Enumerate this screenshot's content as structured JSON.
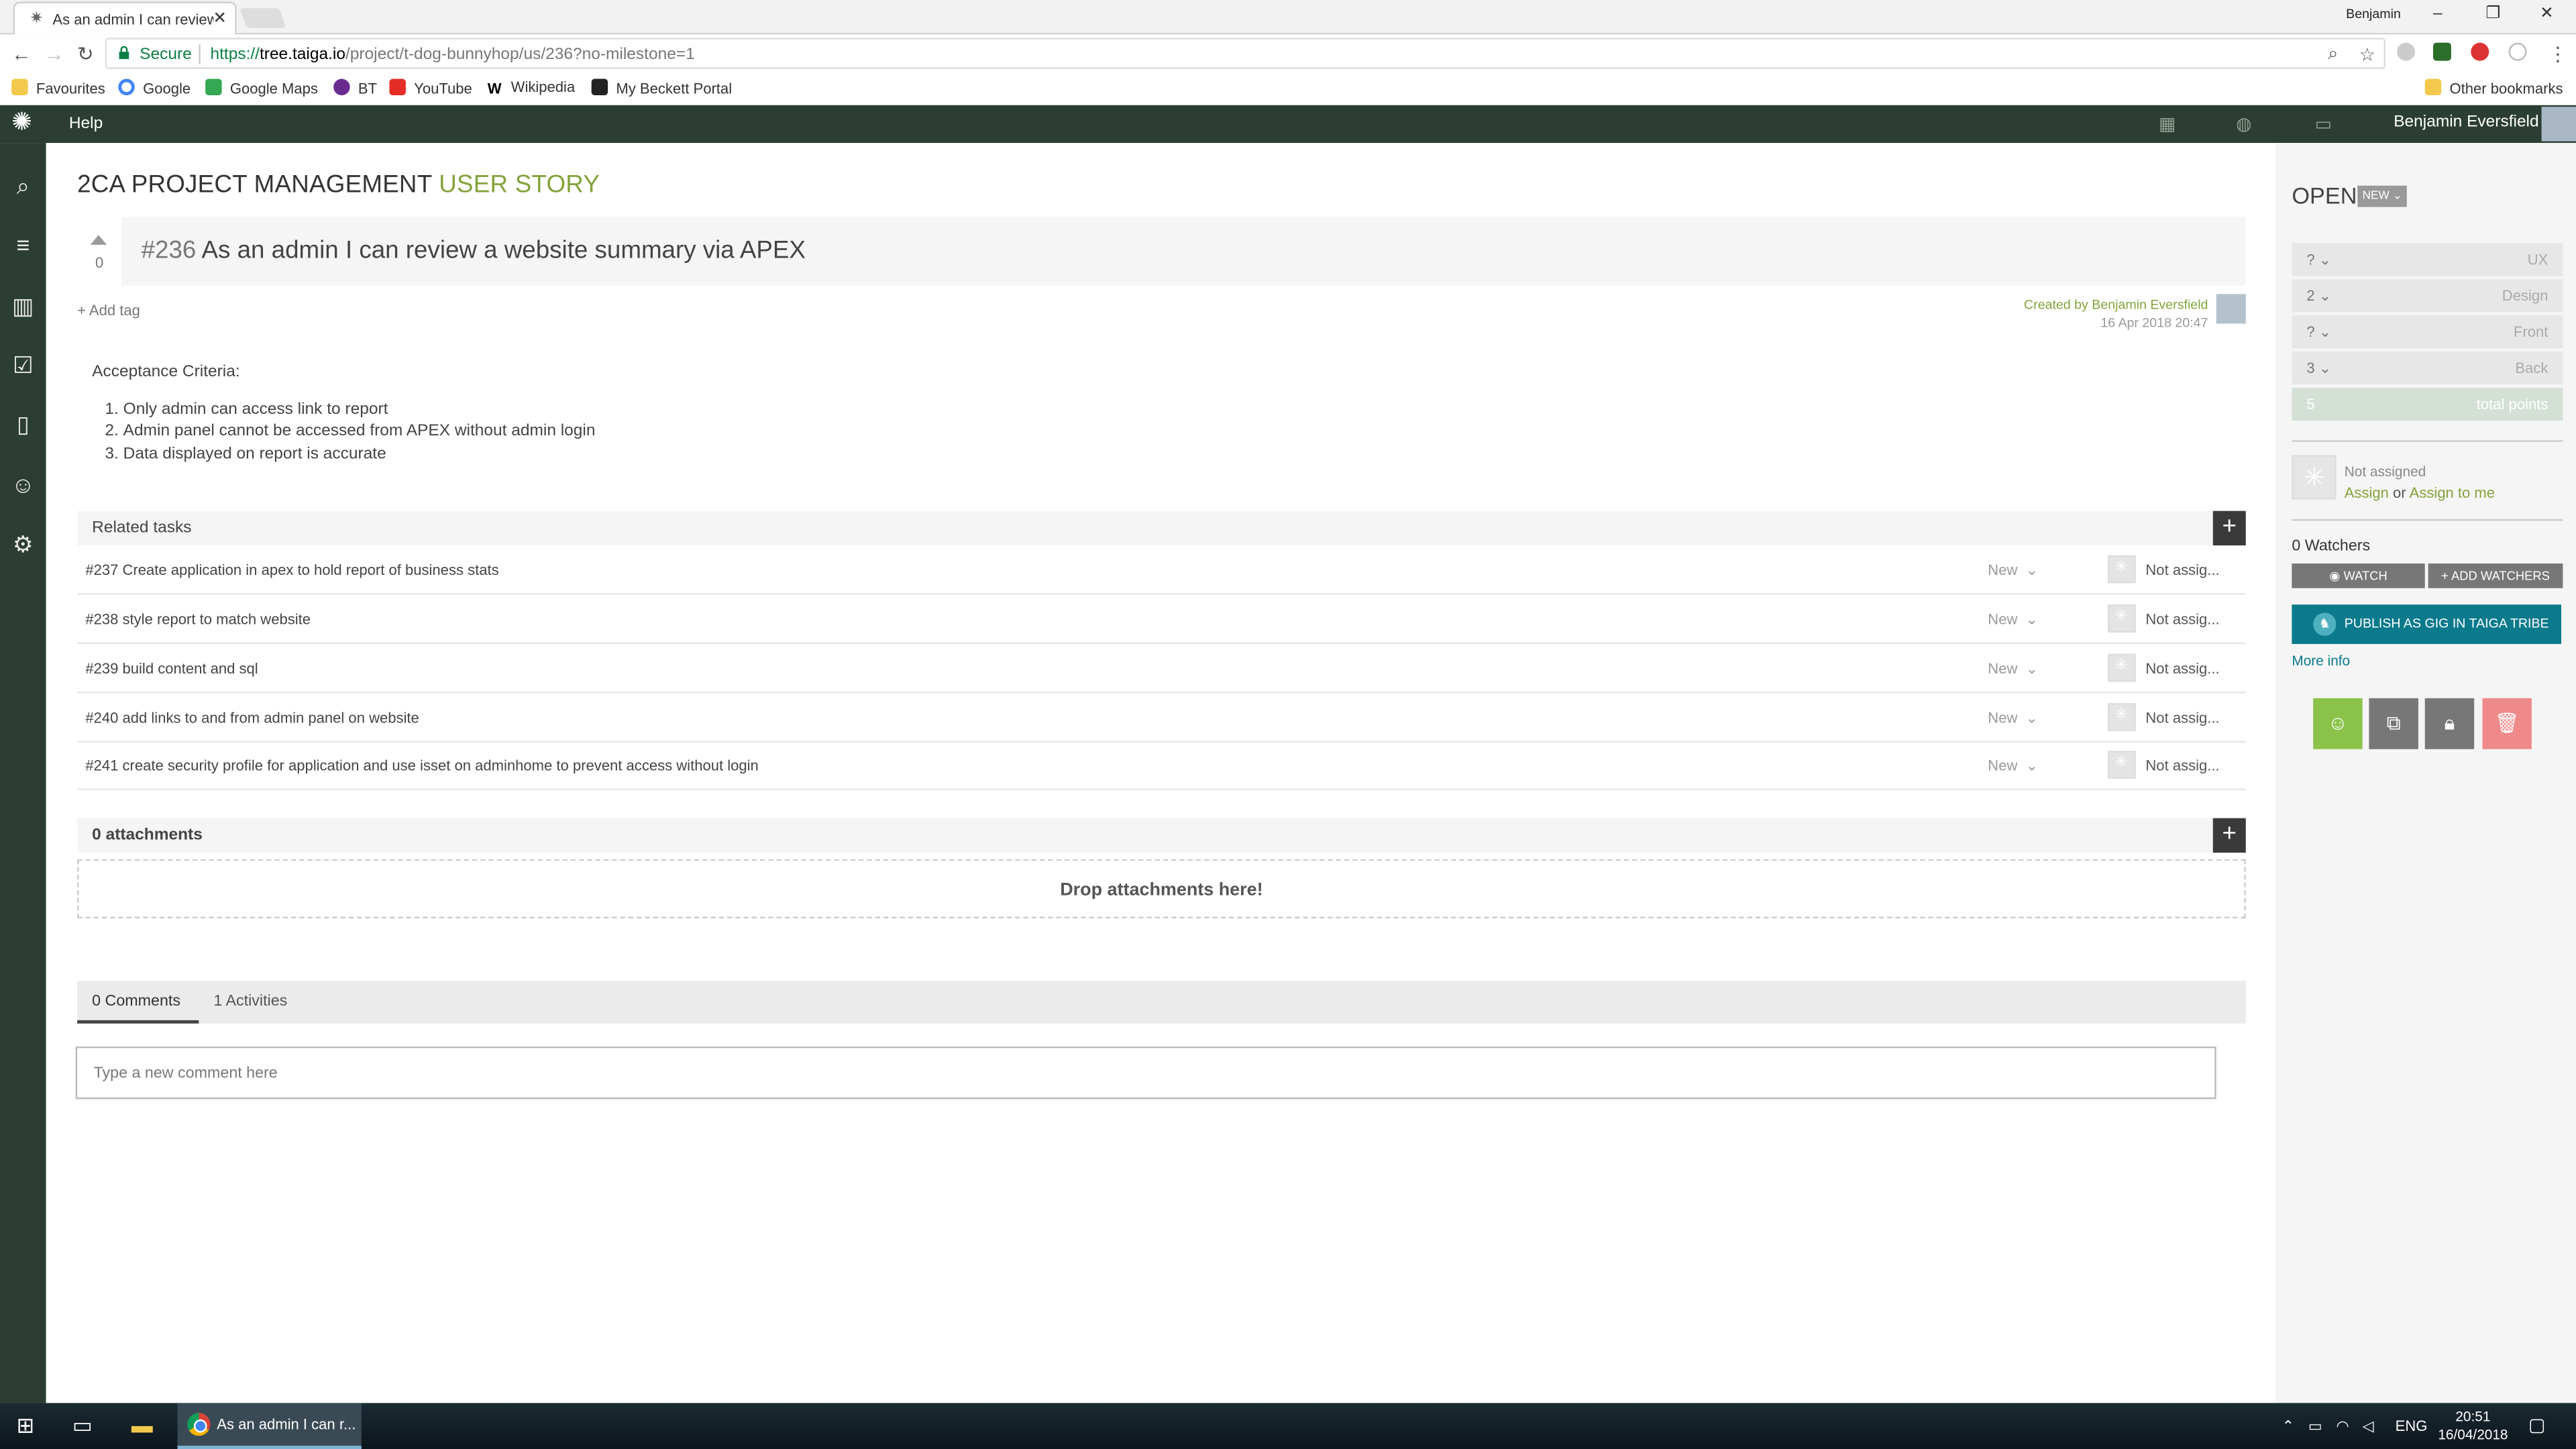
{
  "browser": {
    "tab_title": "As an admin I can review a website summary via APEX",
    "close_glyph": "✕",
    "window_user": "Benjamin",
    "window_controls": [
      "–",
      "❐",
      "✕"
    ],
    "secure_label": "Secure",
    "url_scheme": "https://",
    "url_host": "tree.taiga.io",
    "url_path": "/project/t-dog-bunnyhop/us/236?no-milestone=1",
    "bookmarks": [
      "Favourites",
      "Google",
      "Google Maps",
      "BT",
      "YouTube",
      "Wikipedia",
      "My Beckett Portal"
    ],
    "other_bookmarks": "Other bookmarks"
  },
  "topnav": {
    "help": "Help",
    "user_name": "Benjamin Eversfield"
  },
  "page": {
    "project": "2CA PROJECT MANAGEMENT",
    "section": "USER STORY",
    "ref": "#236",
    "title": "As an admin I can review a website summary via APEX",
    "votes": "0",
    "add_tag": "Add tag",
    "created_by": "Created by Benjamin Eversfield",
    "created_date": "16 Apr 2018 20:47"
  },
  "description": {
    "heading": "Acceptance Criteria:",
    "items": [
      "Only admin can access link to report",
      "Admin panel cannot be accessed from APEX without admin login",
      "Data displayed on report is accurate"
    ]
  },
  "related_tasks": {
    "heading": "Related tasks",
    "add_glyph": "+",
    "tasks": [
      {
        "name": "#237 Create application in apex to hold report of business stats",
        "status": "New",
        "assigned": "Not assig..."
      },
      {
        "name": "#238 style report to match website",
        "status": "New",
        "assigned": "Not assig..."
      },
      {
        "name": "#239 build content and sql",
        "status": "New",
        "assigned": "Not assig..."
      },
      {
        "name": "#240 add links to and from admin panel on website",
        "status": "New",
        "assigned": "Not assig..."
      },
      {
        "name": "#241 create security profile for application and use isset on adminhome to prevent access without login",
        "status": "New",
        "assigned": "Not assig..."
      }
    ]
  },
  "attachments": {
    "heading": "0 attachments",
    "add_glyph": "+",
    "drop_text": "Drop attachments here!"
  },
  "comments": {
    "tab_comments": "0 Comments",
    "tab_activities": "1 Activities",
    "placeholder": "Type a new comment here"
  },
  "sidebar": {
    "status": "OPEN",
    "status_badge": "NEW",
    "points": [
      {
        "value": "?",
        "role": "UX"
      },
      {
        "value": "2",
        "role": "Design"
      },
      {
        "value": "?",
        "role": "Front"
      },
      {
        "value": "3",
        "role": "Back"
      },
      {
        "value": "5",
        "role": "total points"
      }
    ],
    "not_assigned": "Not assigned",
    "assign": "Assign",
    "or": "or",
    "assign_to_me": "Assign to me",
    "watchers": "0 Watchers",
    "watch": "WATCH",
    "add_watchers": "+ ADD WATCHERS",
    "publish": "PUBLISH AS GIG IN TAIGA TRIBE",
    "more_info": "More info"
  },
  "taskbar": {
    "chrome_label": "As an admin I can r...",
    "lang": "ENG",
    "time": "20:51",
    "date": "16/04/2018"
  },
  "colors": {
    "taiga_dark": "#2c3e33",
    "taiga_green": "#83a33a",
    "publish_teal": "#0b7a8c",
    "delete_red": "#ef8a8a"
  }
}
